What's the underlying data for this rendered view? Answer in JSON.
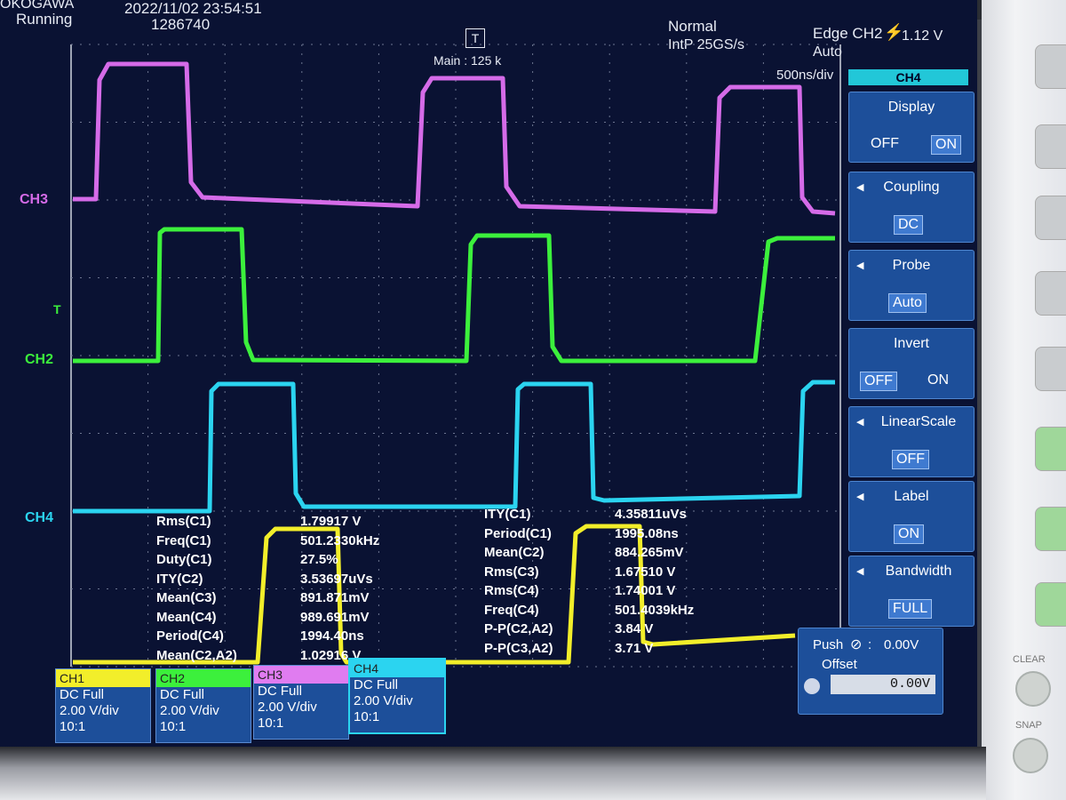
{
  "header": {
    "brand": "OKOGAWA",
    "status": "Running",
    "datetime": "2022/11/02 23:54:51",
    "count": "1286740",
    "mode": "Normal",
    "sampling": "IntP  25GS/s",
    "trigger": "Edge CH2",
    "trigger_level": "1.12 V",
    "trigger_mode": "Auto",
    "main_length": "Main : 125 k",
    "timebase": "500ns/div"
  },
  "channel_labels": {
    "ch3": "CH3",
    "ch2": "CH2",
    "ch4": "CH4",
    "ch1": "CH1"
  },
  "colors": {
    "ch1": "#f2ee2a",
    "ch2": "#3cf03c",
    "ch3": "#d56be8",
    "ch4": "#2bd4f0",
    "screen_bg": "#0a1233",
    "menu_bg": "#1d4f9a"
  },
  "measurements_left": [
    {
      "label": "Rms(C1)",
      "value": "1.79917 V"
    },
    {
      "label": "Freq(C1)",
      "value": "501.2330kHz"
    },
    {
      "label": "Duty(C1)",
      "value": "27.5%"
    },
    {
      "label": "ITY(C2)",
      "value": "3.53697uVs"
    },
    {
      "label": "Mean(C3)",
      "value": "891.871mV"
    },
    {
      "label": "Mean(C4)",
      "value": "989.691mV"
    },
    {
      "label": "Period(C4)",
      "value": "1994.40ns"
    },
    {
      "label": "Mean(C2,A2)",
      "value": "1.02916 V"
    }
  ],
  "measurements_right": [
    {
      "label": "ITY(C1)",
      "value": "4.35811uVs"
    },
    {
      "label": "Period(C1)",
      "value": "1995.08ns"
    },
    {
      "label": "Mean(C2)",
      "value": "884.265mV"
    },
    {
      "label": "Rms(C3)",
      "value": "1.67510 V"
    },
    {
      "label": "Rms(C4)",
      "value": "1.74001 V"
    },
    {
      "label": "Freq(C4)",
      "value": "501.4039kHz"
    },
    {
      "label": "P-P(C2,A2)",
      "value": "3.84 V"
    },
    {
      "label": "P-P(C3,A2)",
      "value": "3.71 V"
    }
  ],
  "menu": {
    "title": "CH4",
    "display": {
      "label": "Display",
      "off": "OFF",
      "on": "ON",
      "selected": "ON"
    },
    "coupling": {
      "label": "Coupling",
      "value": "DC"
    },
    "probe": {
      "label": "Probe",
      "value": "Auto"
    },
    "invert": {
      "label": "Invert",
      "off": "OFF",
      "on": "ON",
      "selected": "OFF"
    },
    "linearscale": {
      "label": "LinearScale",
      "value": "OFF"
    },
    "label": {
      "label": "Label",
      "value": "ON"
    },
    "bandwidth": {
      "label": "Bandwidth",
      "value": "FULL"
    }
  },
  "offset": {
    "push": "Push",
    "value_top": "0.00V",
    "label": "Offset",
    "value": "0.00V"
  },
  "channel_tabs": [
    {
      "name": "CH1",
      "coupling": "DC Full",
      "scale": "2.00 V/div",
      "probe": "10:1"
    },
    {
      "name": "CH2",
      "coupling": "DC Full",
      "scale": "2.00 V/div",
      "probe": "10:1"
    },
    {
      "name": "CH3",
      "coupling": "DC Full",
      "scale": "2.00 V/div",
      "probe": "10:1"
    },
    {
      "name": "CH4",
      "coupling": "DC Full",
      "scale": "2.00 V/div",
      "probe": "10:1"
    }
  ],
  "buttons": {
    "clear": "CLEAR",
    "snap": "SNAP"
  }
}
